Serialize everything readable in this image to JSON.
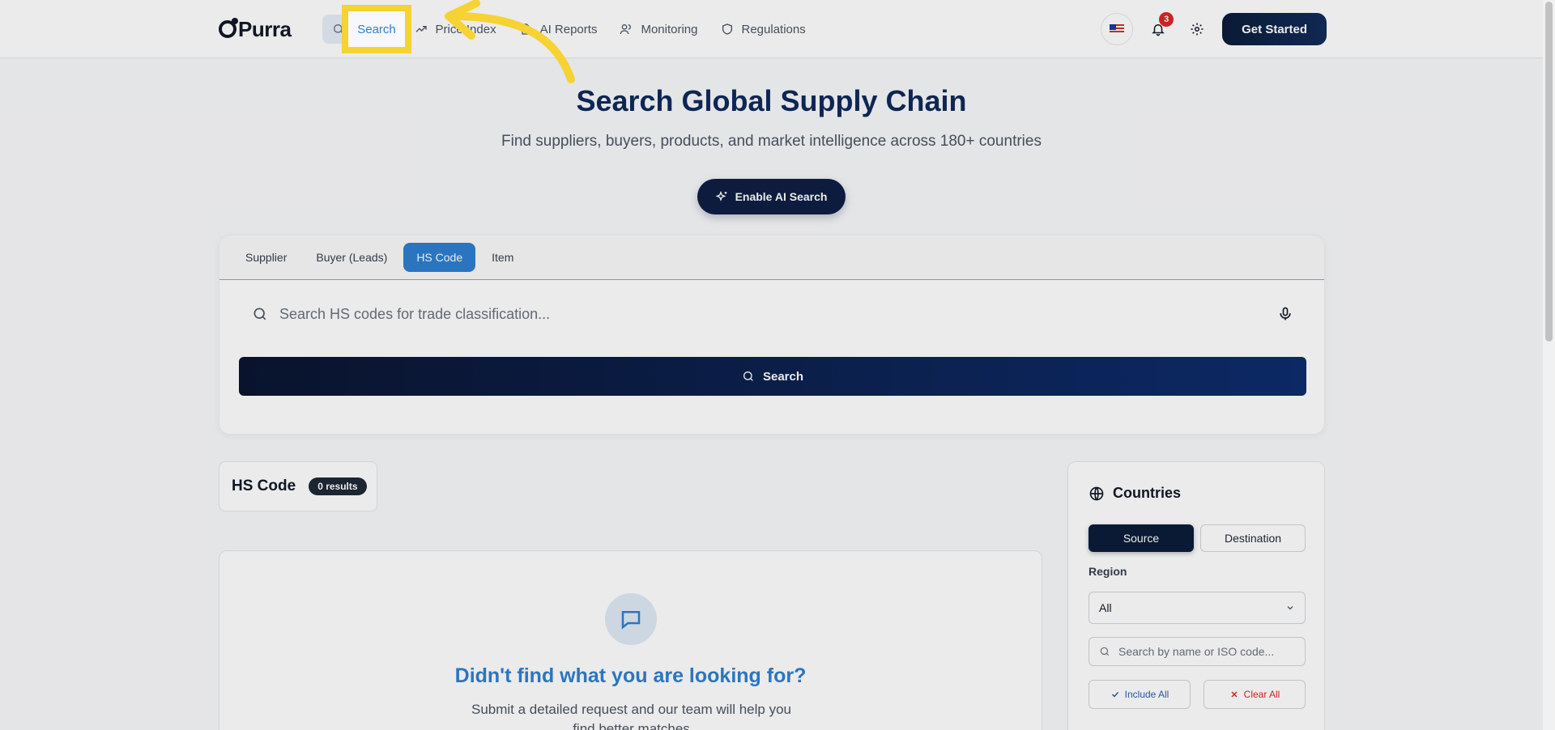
{
  "brand": {
    "name": "Purra"
  },
  "nav": {
    "items": [
      {
        "label": "Search",
        "icon": "search-icon"
      },
      {
        "label": "Price Index",
        "icon": "trending-up-icon"
      },
      {
        "label": "AI Reports",
        "icon": "file-icon"
      },
      {
        "label": "Monitoring",
        "icon": "users-icon"
      },
      {
        "label": "Regulations",
        "icon": "shield-icon"
      }
    ]
  },
  "header": {
    "notifications_count": "3",
    "cta_label": "Get Started",
    "language_icon": "us-flag-icon"
  },
  "hero": {
    "title": "Search Global Supply Chain",
    "subtitle": "Find suppliers, buyers, products, and market intelligence across 180+ countries",
    "ai_button": "Enable AI Search"
  },
  "search": {
    "tabs": [
      "Supplier",
      "Buyer (Leads)",
      "HS Code",
      "Item"
    ],
    "active_tab": "HS Code",
    "placeholder": "Search HS codes for trade classification...",
    "submit_label": "Search"
  },
  "results": {
    "title": "HS Code",
    "count_label": "0 results"
  },
  "empty_state": {
    "title": "Didn't find what you are looking for?",
    "text": "Submit a detailed request and our team will help you find better matches"
  },
  "countries": {
    "title": "Countries",
    "modes": [
      "Source",
      "Destination"
    ],
    "active_mode": "Source",
    "region_label": "Region",
    "region_value": "All",
    "search_placeholder": "Search by name or ISO code...",
    "include_all": "Include All",
    "clear_all": "Clear All"
  },
  "colors": {
    "accent": "#2f7fd1",
    "navy": "#0b1d3a",
    "highlight": "#f6d233",
    "danger": "#dc2626"
  }
}
